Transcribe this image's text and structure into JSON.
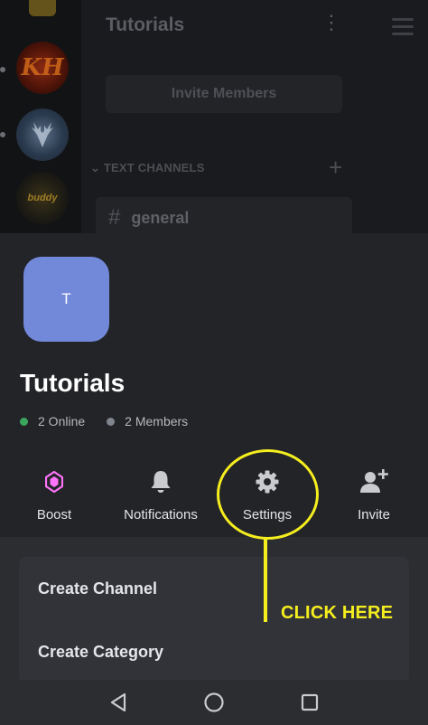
{
  "background": {
    "server_title": "Tutorials",
    "invite_button_label": "Invite Members",
    "section_label": "TEXT CHANNELS",
    "channel_name": "general",
    "server_icons": [
      "kh-server-avatar",
      "deer-server-avatar",
      "buddy-server-avatar"
    ]
  },
  "sheet": {
    "server_icon_letter": "T",
    "server_name": "Tutorials",
    "online_text": "2 Online",
    "members_text": "2 Members",
    "actions": [
      {
        "label": "Boost",
        "icon": "boost-gem-icon"
      },
      {
        "label": "Notifications",
        "icon": "bell-icon"
      },
      {
        "label": "Settings",
        "icon": "gear-icon"
      },
      {
        "label": "Invite",
        "icon": "add-user-icon"
      }
    ],
    "menu": [
      "Create Channel",
      "Create Category"
    ]
  },
  "annotation": {
    "callout_text": "CLICK HERE",
    "color": "#f5ee1f"
  },
  "colors": {
    "online": "#3ba55d",
    "offline": "#80848e",
    "server_icon_bg": "#7289da",
    "boost": "#ff73fa"
  },
  "navbar": {
    "buttons": [
      "back-icon",
      "home-icon",
      "recents-icon"
    ]
  }
}
